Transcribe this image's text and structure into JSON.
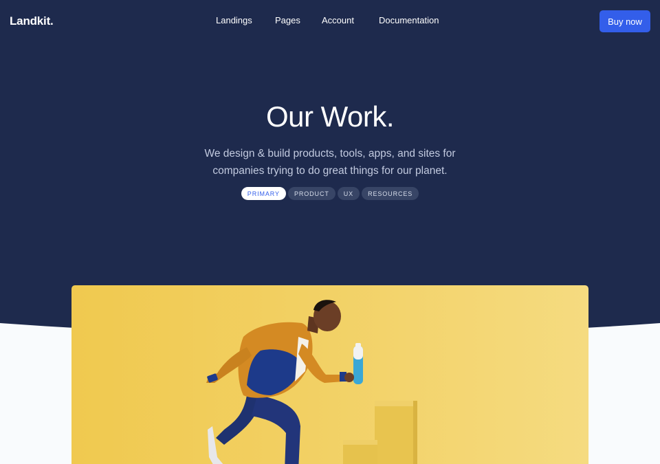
{
  "navbar": {
    "brand": "Landkit.",
    "links": [
      "Landings",
      "Pages",
      "Account",
      "Documentation"
    ],
    "cta_label": "Buy now"
  },
  "hero": {
    "title": "Our Work.",
    "lead_line1": "We design & build products, tools, apps, and sites for",
    "lead_line2": "companies trying to do great things for our planet.",
    "filters": [
      "PRIMARY",
      "PRODUCT",
      "UX",
      "RESOURCES"
    ],
    "active_filter": "PRIMARY"
  },
  "colors": {
    "hero_background": "#1e2a4d",
    "accent": "#335eea",
    "page_background": "#f9fbfd",
    "feature_image_background": "#f2d063"
  },
  "feature_image": {
    "subject": "man running up yellow steps holding a water bottle"
  }
}
